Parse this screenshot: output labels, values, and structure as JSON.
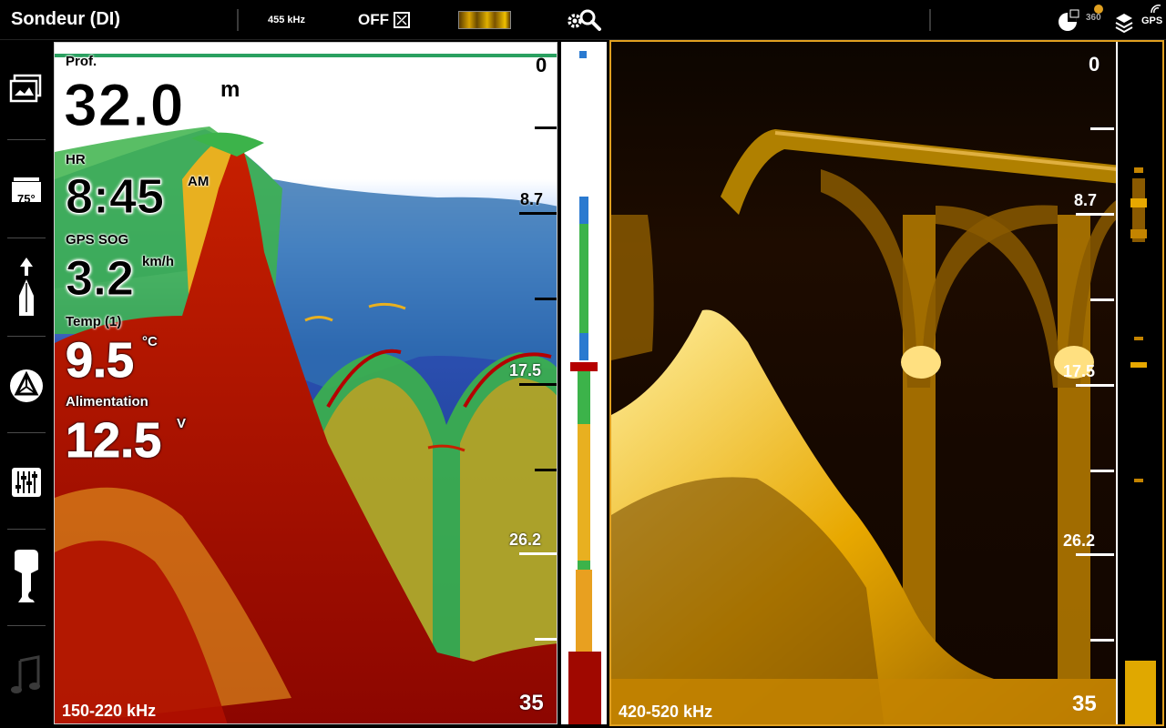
{
  "topbar": {
    "title": "Sondeur (DI)",
    "frequency": "455 kHz",
    "off_label": "OFF",
    "icons": [
      "offset-icon",
      "image-thumbnail",
      "settings-search-icon",
      "radar-icon",
      "360-icon",
      "layers-icon",
      "gps-icon"
    ],
    "status_360": "360",
    "status_gps": "GPS"
  },
  "sidebar": {
    "items": [
      {
        "name": "views-icon"
      },
      {
        "name": "temperature-icon",
        "label": "75°"
      },
      {
        "name": "navigation-icon"
      },
      {
        "name": "chart-icon"
      },
      {
        "name": "equalizer-icon"
      },
      {
        "name": "outboard-motor-icon"
      },
      {
        "name": "music-icon"
      }
    ]
  },
  "readouts": {
    "depth": {
      "label": "Prof.",
      "value": "32.0",
      "unit": "m"
    },
    "time": {
      "label": "HR",
      "value": "8:45",
      "unit": "AM"
    },
    "sog": {
      "label": "GPS SOG",
      "value": "3.2",
      "unit": "km/h"
    },
    "temp": {
      "label": "Temp (1)",
      "value": "9.5",
      "unit": "°C"
    },
    "power": {
      "label": "Alimentation",
      "value": "12.5",
      "unit": "V"
    }
  },
  "left_panel": {
    "frequency_range": "150-220 kHz",
    "scale": [
      "0",
      "8.7",
      "17.5",
      "26.2",
      "35"
    ]
  },
  "right_panel": {
    "frequency_range": "420-520 kHz",
    "scale": [
      "0",
      "8.7",
      "17.5",
      "26.2",
      "35"
    ]
  },
  "colors": {
    "accent": "#e0a020",
    "bottom_red": "#9b0a00",
    "water_blue": "#1b3a8c",
    "di_gold": "#f0b400"
  }
}
